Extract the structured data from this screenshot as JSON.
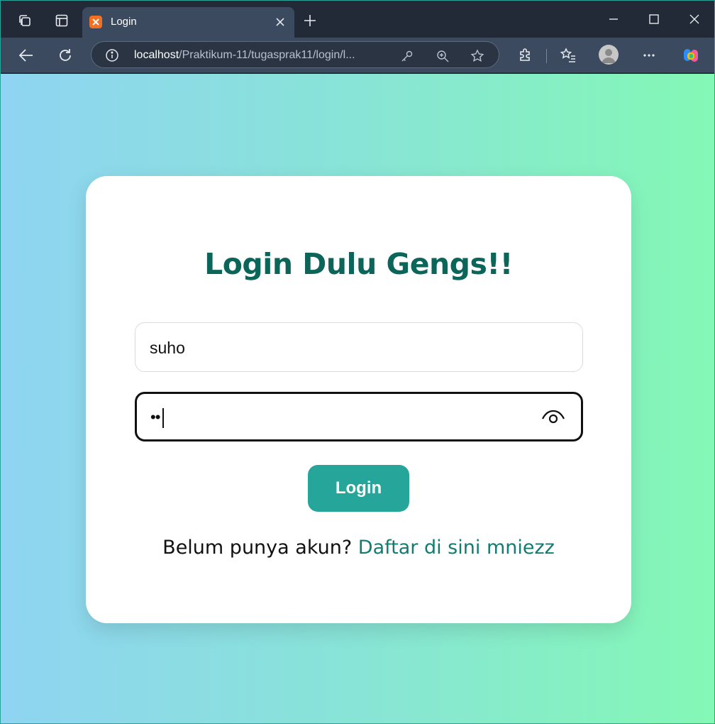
{
  "browser": {
    "tab": {
      "title": "Login",
      "favicon": "xampp-icon"
    },
    "address": {
      "host": "localhost",
      "path": "/Praktikum-11/tugasprak11/login/l..."
    },
    "icons": {
      "workspaces": "workspaces-icon",
      "tab_actions": "tab-actions-icon",
      "close_tab": "close-icon",
      "new_tab": "plus-icon",
      "minimize": "minimize-icon",
      "maximize": "maximize-icon",
      "close_window": "close-icon",
      "back": "back-arrow-icon",
      "refresh": "refresh-icon",
      "site_info": "info-icon",
      "password_key": "key-icon",
      "zoom": "zoom-in-icon",
      "favorite": "star-icon",
      "extensions": "puzzle-icon",
      "favorites": "favorites-icon",
      "profile": "avatar",
      "more": "more-icon",
      "copilot": "copilot-icon"
    }
  },
  "page": {
    "heading": "Login Dulu Gengs!!",
    "username_value": "suho",
    "password_dots": "••",
    "login_label": "Login",
    "signup_prompt": "Belum punya akun?",
    "signup_link": "Daftar di sini mniezz"
  },
  "colors": {
    "heading": "#0b6659",
    "button": "#26a69a",
    "link": "#127c71",
    "gradient_start": "#8fd4f2",
    "gradient_end": "#84f8b5"
  }
}
